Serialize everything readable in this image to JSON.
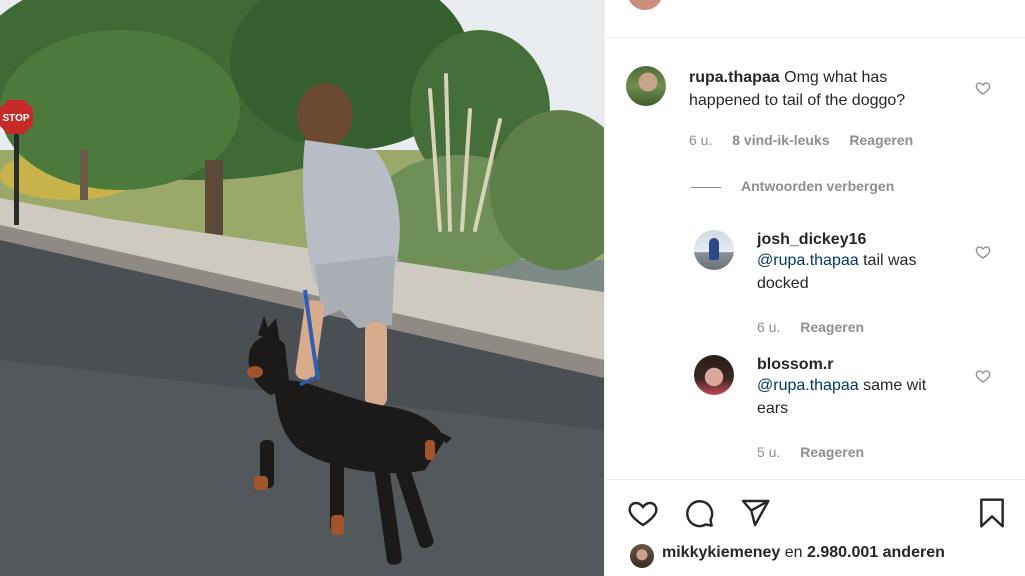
{
  "top_peek": {
    "text": ""
  },
  "comments": [
    {
      "username": "rupa.thapaa",
      "text": "Omg what has happened to tail of the doggo?",
      "time": "6 u.",
      "likes": "8 vind-ik-leuks",
      "reply_label": "Reageren"
    }
  ],
  "hide_replies_label": "Antwoorden verbergen",
  "replies": [
    {
      "username": "josh_dickey16",
      "mention": "@rupa.thapaa",
      "text": " tail was docked",
      "time": "6 u.",
      "reply_label": "Reageren"
    },
    {
      "username": "blossom.r",
      "mention": "@rupa.thapaa",
      "text": " same wit ears",
      "time": "5 u.",
      "reply_label": "Reageren"
    }
  ],
  "likes_line": {
    "user": "mikkykiemeney",
    "connector": " en ",
    "count": "2.980.001 anderen"
  },
  "icons": {
    "like": "heart-icon",
    "comment": "comment-icon",
    "share": "paper-plane-icon",
    "save": "bookmark-icon",
    "comment_like": "heart-outline-icon"
  },
  "colors": {
    "mention": "#00376b",
    "meta": "#8e8e8e",
    "text": "#262626"
  }
}
